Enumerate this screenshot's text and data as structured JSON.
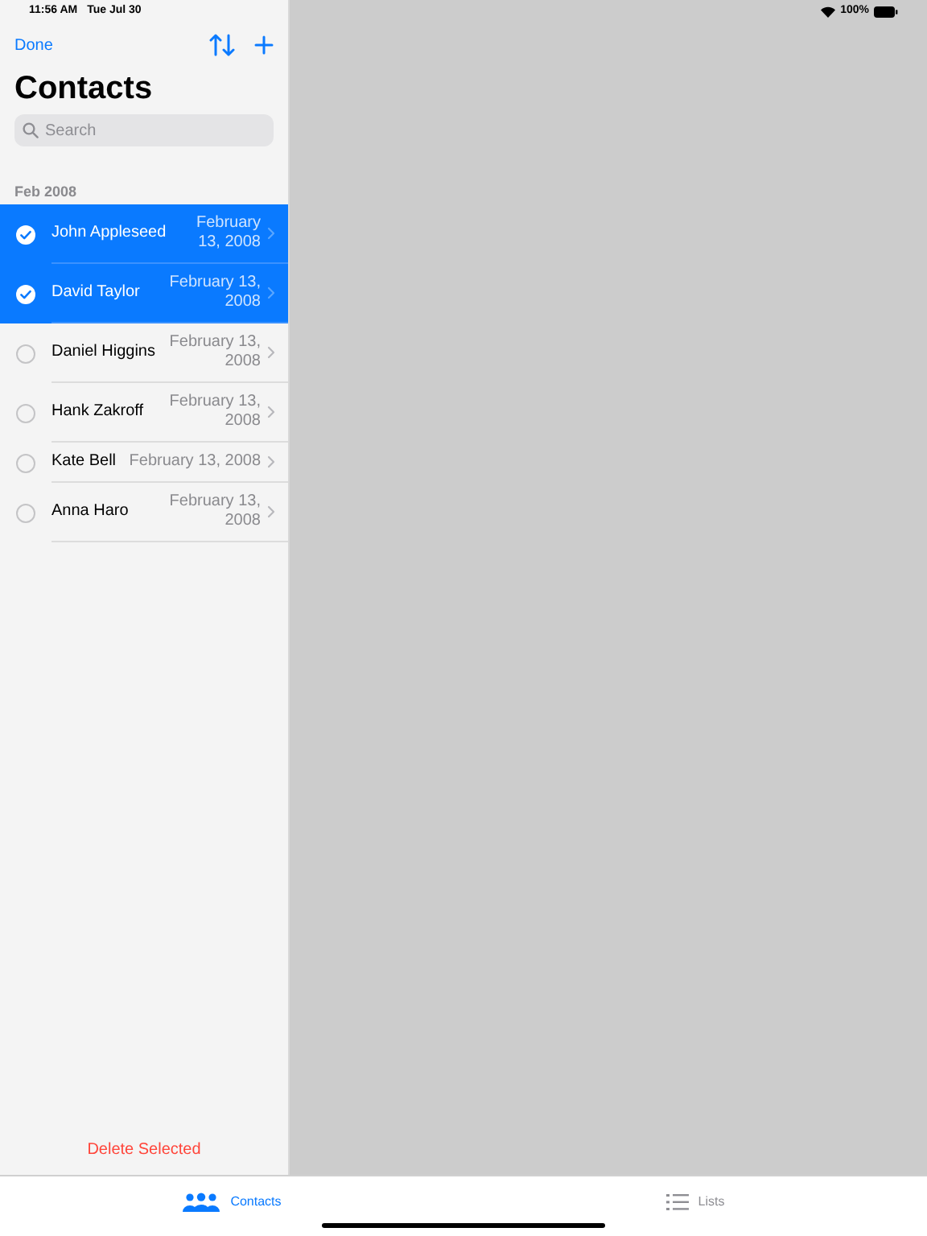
{
  "status_bar": {
    "time": "11:56 AM",
    "date": "Tue Jul 30",
    "battery": "100%"
  },
  "nav": {
    "done": "Done"
  },
  "title": "Contacts",
  "search": {
    "placeholder": "Search"
  },
  "section": "Feb 2008",
  "contacts": [
    {
      "name": "John Appleseed",
      "date": "February 13, 2008",
      "selected": true
    },
    {
      "name": "David Taylor",
      "date": "February 13, 2008",
      "selected": true
    },
    {
      "name": "Daniel Higgins",
      "date": "February 13, 2008",
      "selected": false
    },
    {
      "name": "Hank Zakroff",
      "date": "February 13, 2008",
      "selected": false
    },
    {
      "name": "Kate Bell",
      "date": "February 13, 2008",
      "selected": false
    },
    {
      "name": "Anna Haro",
      "date": "February 13, 2008",
      "selected": false
    }
  ],
  "delete_button": "Delete Selected",
  "tabs": [
    {
      "label": "Contacts",
      "selected": true
    },
    {
      "label": "Lists",
      "selected": false
    }
  ]
}
